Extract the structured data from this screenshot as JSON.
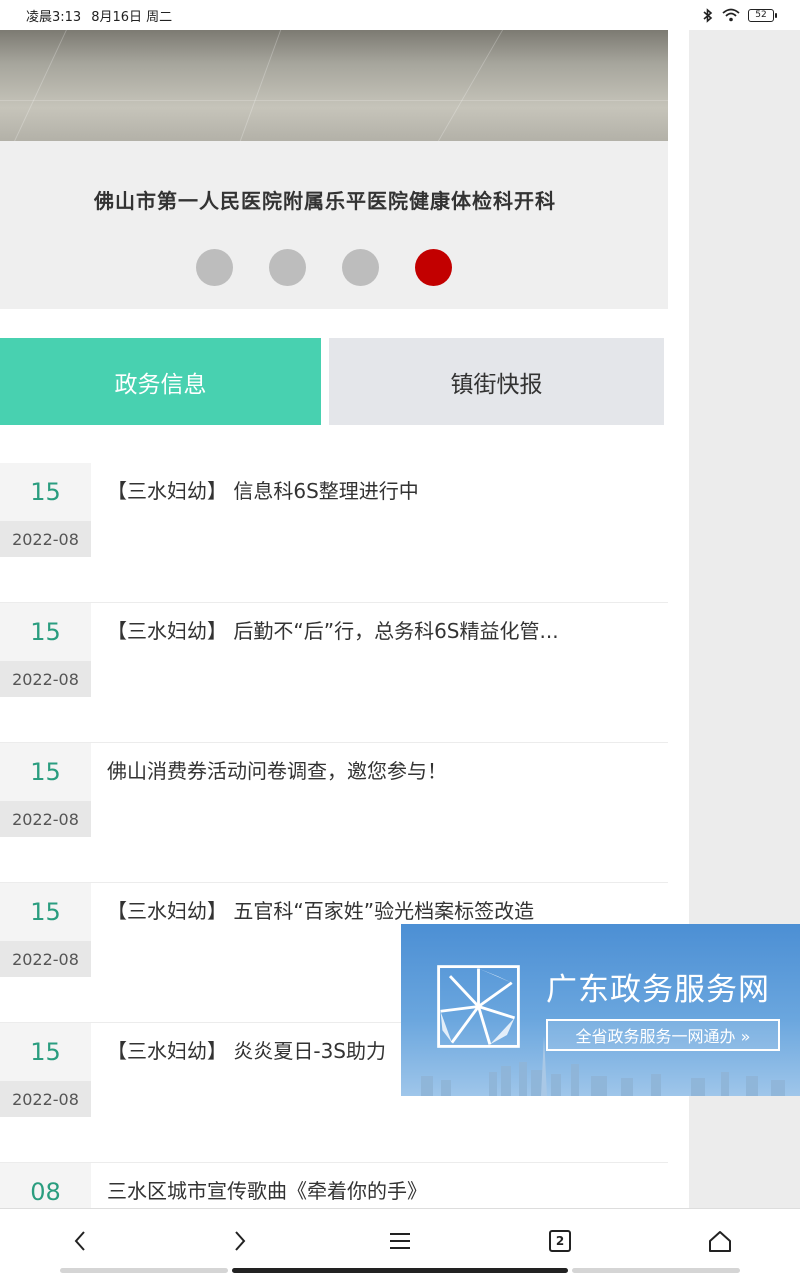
{
  "status_bar": {
    "time": "凌晨3:13",
    "date": "8月16日 周二",
    "battery": "52"
  },
  "carousel": {
    "caption": "佛山市第一人民医院附属乐平医院健康体检科开科",
    "dot_count": 4,
    "active_dot": 4
  },
  "tabs": [
    {
      "label": "政务信息",
      "active": true
    },
    {
      "label": "镇街快报",
      "active": false
    }
  ],
  "news": [
    {
      "day": "15",
      "year_month": "2022-08",
      "title": "【三水妇幼】 信息科6S整理进行中"
    },
    {
      "day": "15",
      "year_month": "2022-08",
      "title": "【三水妇幼】 后勤不“后”行，总务科6S精益化管..."
    },
    {
      "day": "15",
      "year_month": "2022-08",
      "title": "佛山消费券活动问卷调查，邀您参与！"
    },
    {
      "day": "15",
      "year_month": "2022-08",
      "title": "【三水妇幼】 五官科“百家姓”验光档案标签改造"
    },
    {
      "day": "15",
      "year_month": "2022-08",
      "title": "【三水妇幼】 炎炎夏日-3S助力"
    },
    {
      "day": "08",
      "year_month": "",
      "title": "三水区城市宣传歌曲《牵着你的手》"
    }
  ],
  "ad": {
    "title": "广东政务服务网",
    "button": "全省政务服务一网通办 »"
  },
  "bottom_nav": {
    "back_icon": "chevron-left-icon",
    "forward_icon": "chevron-right-icon",
    "menu_icon": "hamburger-icon",
    "tab_count": "2",
    "home_icon": "home-icon"
  }
}
